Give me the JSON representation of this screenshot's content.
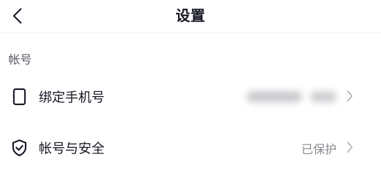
{
  "navbar": {
    "title": "设置",
    "back_icon": "chevron-left-icon"
  },
  "account_section": {
    "header": "帐号",
    "items": [
      {
        "label": "绑定手机号",
        "icon": "phone-icon",
        "value": "",
        "value_blurred": true,
        "chevron": "chevron-right-icon"
      },
      {
        "label": "帐号与安全",
        "icon": "shield-check-icon",
        "value": "已保护",
        "chevron": "chevron-right-icon"
      }
    ]
  },
  "colors": {
    "text_primary": "#161823",
    "text_secondary": "#8a8b91",
    "background": "#ffffff"
  }
}
